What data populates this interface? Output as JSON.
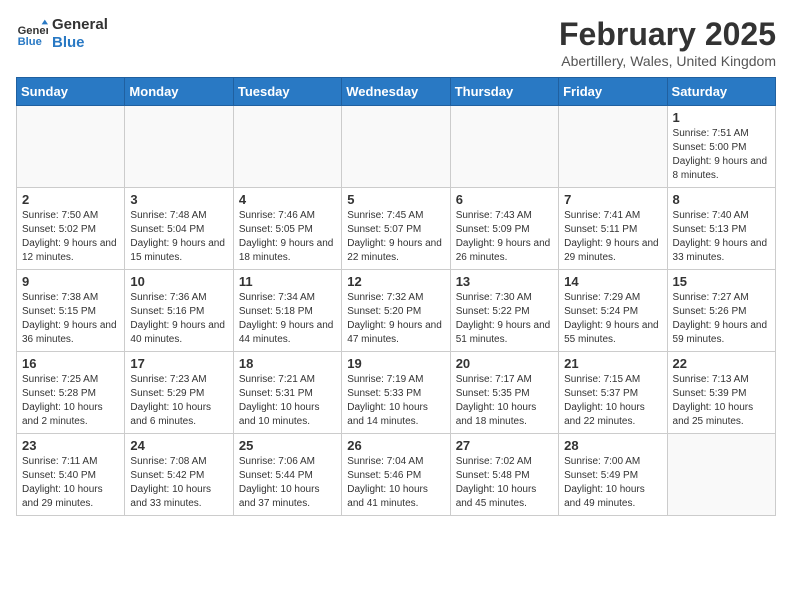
{
  "header": {
    "logo_line1": "General",
    "logo_line2": "Blue",
    "main_title": "February 2025",
    "subtitle": "Abertillery, Wales, United Kingdom"
  },
  "calendar": {
    "weekdays": [
      "Sunday",
      "Monday",
      "Tuesday",
      "Wednesday",
      "Thursday",
      "Friday",
      "Saturday"
    ],
    "weeks": [
      [
        {
          "day": "",
          "info": ""
        },
        {
          "day": "",
          "info": ""
        },
        {
          "day": "",
          "info": ""
        },
        {
          "day": "",
          "info": ""
        },
        {
          "day": "",
          "info": ""
        },
        {
          "day": "",
          "info": ""
        },
        {
          "day": "1",
          "info": "Sunrise: 7:51 AM\nSunset: 5:00 PM\nDaylight: 9 hours and 8 minutes."
        }
      ],
      [
        {
          "day": "2",
          "info": "Sunrise: 7:50 AM\nSunset: 5:02 PM\nDaylight: 9 hours and 12 minutes."
        },
        {
          "day": "3",
          "info": "Sunrise: 7:48 AM\nSunset: 5:04 PM\nDaylight: 9 hours and 15 minutes."
        },
        {
          "day": "4",
          "info": "Sunrise: 7:46 AM\nSunset: 5:05 PM\nDaylight: 9 hours and 18 minutes."
        },
        {
          "day": "5",
          "info": "Sunrise: 7:45 AM\nSunset: 5:07 PM\nDaylight: 9 hours and 22 minutes."
        },
        {
          "day": "6",
          "info": "Sunrise: 7:43 AM\nSunset: 5:09 PM\nDaylight: 9 hours and 26 minutes."
        },
        {
          "day": "7",
          "info": "Sunrise: 7:41 AM\nSunset: 5:11 PM\nDaylight: 9 hours and 29 minutes."
        },
        {
          "day": "8",
          "info": "Sunrise: 7:40 AM\nSunset: 5:13 PM\nDaylight: 9 hours and 33 minutes."
        }
      ],
      [
        {
          "day": "9",
          "info": "Sunrise: 7:38 AM\nSunset: 5:15 PM\nDaylight: 9 hours and 36 minutes."
        },
        {
          "day": "10",
          "info": "Sunrise: 7:36 AM\nSunset: 5:16 PM\nDaylight: 9 hours and 40 minutes."
        },
        {
          "day": "11",
          "info": "Sunrise: 7:34 AM\nSunset: 5:18 PM\nDaylight: 9 hours and 44 minutes."
        },
        {
          "day": "12",
          "info": "Sunrise: 7:32 AM\nSunset: 5:20 PM\nDaylight: 9 hours and 47 minutes."
        },
        {
          "day": "13",
          "info": "Sunrise: 7:30 AM\nSunset: 5:22 PM\nDaylight: 9 hours and 51 minutes."
        },
        {
          "day": "14",
          "info": "Sunrise: 7:29 AM\nSunset: 5:24 PM\nDaylight: 9 hours and 55 minutes."
        },
        {
          "day": "15",
          "info": "Sunrise: 7:27 AM\nSunset: 5:26 PM\nDaylight: 9 hours and 59 minutes."
        }
      ],
      [
        {
          "day": "16",
          "info": "Sunrise: 7:25 AM\nSunset: 5:28 PM\nDaylight: 10 hours and 2 minutes."
        },
        {
          "day": "17",
          "info": "Sunrise: 7:23 AM\nSunset: 5:29 PM\nDaylight: 10 hours and 6 minutes."
        },
        {
          "day": "18",
          "info": "Sunrise: 7:21 AM\nSunset: 5:31 PM\nDaylight: 10 hours and 10 minutes."
        },
        {
          "day": "19",
          "info": "Sunrise: 7:19 AM\nSunset: 5:33 PM\nDaylight: 10 hours and 14 minutes."
        },
        {
          "day": "20",
          "info": "Sunrise: 7:17 AM\nSunset: 5:35 PM\nDaylight: 10 hours and 18 minutes."
        },
        {
          "day": "21",
          "info": "Sunrise: 7:15 AM\nSunset: 5:37 PM\nDaylight: 10 hours and 22 minutes."
        },
        {
          "day": "22",
          "info": "Sunrise: 7:13 AM\nSunset: 5:39 PM\nDaylight: 10 hours and 25 minutes."
        }
      ],
      [
        {
          "day": "23",
          "info": "Sunrise: 7:11 AM\nSunset: 5:40 PM\nDaylight: 10 hours and 29 minutes."
        },
        {
          "day": "24",
          "info": "Sunrise: 7:08 AM\nSunset: 5:42 PM\nDaylight: 10 hours and 33 minutes."
        },
        {
          "day": "25",
          "info": "Sunrise: 7:06 AM\nSunset: 5:44 PM\nDaylight: 10 hours and 37 minutes."
        },
        {
          "day": "26",
          "info": "Sunrise: 7:04 AM\nSunset: 5:46 PM\nDaylight: 10 hours and 41 minutes."
        },
        {
          "day": "27",
          "info": "Sunrise: 7:02 AM\nSunset: 5:48 PM\nDaylight: 10 hours and 45 minutes."
        },
        {
          "day": "28",
          "info": "Sunrise: 7:00 AM\nSunset: 5:49 PM\nDaylight: 10 hours and 49 minutes."
        },
        {
          "day": "",
          "info": ""
        }
      ]
    ]
  }
}
